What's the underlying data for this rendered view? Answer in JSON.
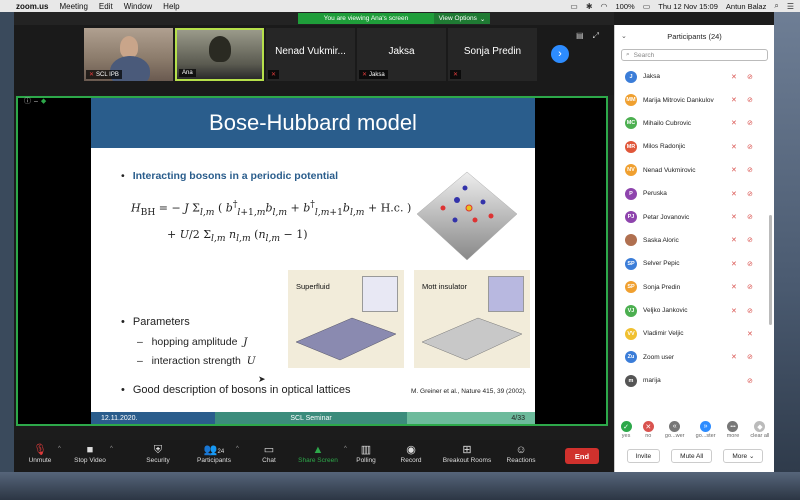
{
  "menubar": {
    "app": "zoom.us",
    "items": [
      "Meeting",
      "Edit",
      "Window",
      "Help"
    ],
    "battery": "100%",
    "clock": "Thu 12 Nov 15:09",
    "user": "Antun Balaz"
  },
  "banner": {
    "viewing": "You are viewing Ana's screen",
    "view_options": "View Options"
  },
  "thumbs": [
    {
      "name": "SCL IPB",
      "kind": "video"
    },
    {
      "name": "Ana",
      "kind": "video"
    },
    {
      "name": "Nenad Vukmir...",
      "kind": "name"
    },
    {
      "name": "Jaksa",
      "kind": "name",
      "label": "Jaksa"
    },
    {
      "name": "Sonja Predin",
      "kind": "name"
    }
  ],
  "slide": {
    "title": "Bose-Hubbard model",
    "bullet1": "Interacting bosons in a periodic potential",
    "bullet2": "Parameters",
    "sub1": "hopping amplitude",
    "sub1_sym": "J",
    "sub2": "interaction strength",
    "sub2_sym": "U",
    "panel1": "Superfluid",
    "panel2": "Mott insulator",
    "bullet3": "Good description of bosons in optical lattices",
    "citation": "M. Greiner et al., Nature 415, 39 (2002).",
    "footer_date": "12.11.2020.",
    "footer_center": "SCL Seminar",
    "footer_page": "4/33"
  },
  "toolbar": {
    "unmute": "Unmute",
    "stop_video": "Stop Video",
    "security": "Security",
    "participants": "Participants",
    "participants_count": "24",
    "chat": "Chat",
    "share": "Share Screen",
    "polling": "Polling",
    "record": "Record",
    "breakout": "Breakout Rooms",
    "reactions": "Reactions",
    "end": "End"
  },
  "participants_panel": {
    "title": "Participants (24)",
    "search_placeholder": "Search",
    "people": [
      {
        "initials": "J",
        "name": "Jaksa",
        "color": "#3b7dd8"
      },
      {
        "initials": "MM",
        "name": "Marija Mitrovic Dankulov",
        "color": "#f0a030"
      },
      {
        "initials": "MC",
        "name": "Mihailo Cubrovic",
        "color": "#4caf50"
      },
      {
        "initials": "MR",
        "name": "Milos Radonjic",
        "color": "#e0573a"
      },
      {
        "initials": "NV",
        "name": "Nenad Vukmirovic",
        "color": "#f0a030"
      },
      {
        "initials": "P",
        "name": "Peruska",
        "color": "#8e44ad"
      },
      {
        "initials": "PJ",
        "name": "Petar Jovanovic",
        "color": "#8e44ad"
      },
      {
        "initials": "",
        "name": "Saska Aloric",
        "color": "#b07050"
      },
      {
        "initials": "SP",
        "name": "Selver Pepic",
        "color": "#3b7dd8"
      },
      {
        "initials": "SP",
        "name": "Sonja Predin",
        "color": "#f0a030"
      },
      {
        "initials": "VJ",
        "name": "Veljko Jankovic",
        "color": "#4caf50"
      },
      {
        "initials": "VV",
        "name": "Vladimir Veljic",
        "color": "#f0c030"
      },
      {
        "initials": "Zu",
        "name": "Zoom user",
        "color": "#3b7dd8"
      },
      {
        "initials": "m",
        "name": "marija",
        "color": "#555555"
      }
    ],
    "reactions": [
      {
        "label": "yes",
        "symbol": "✓",
        "color": "#2da84a"
      },
      {
        "label": "no",
        "symbol": "✕",
        "color": "#d9534f"
      },
      {
        "label": "go...wer",
        "symbol": "«",
        "color": "#777777"
      },
      {
        "label": "go...ster",
        "symbol": "»",
        "color": "#2d8cff"
      },
      {
        "label": "more",
        "symbol": "•••",
        "color": "#777777"
      },
      {
        "label": "clear all",
        "symbol": "◆",
        "color": "#bbbbbb"
      }
    ],
    "invite": "Invite",
    "mute_all": "Mute All",
    "more": "More"
  }
}
